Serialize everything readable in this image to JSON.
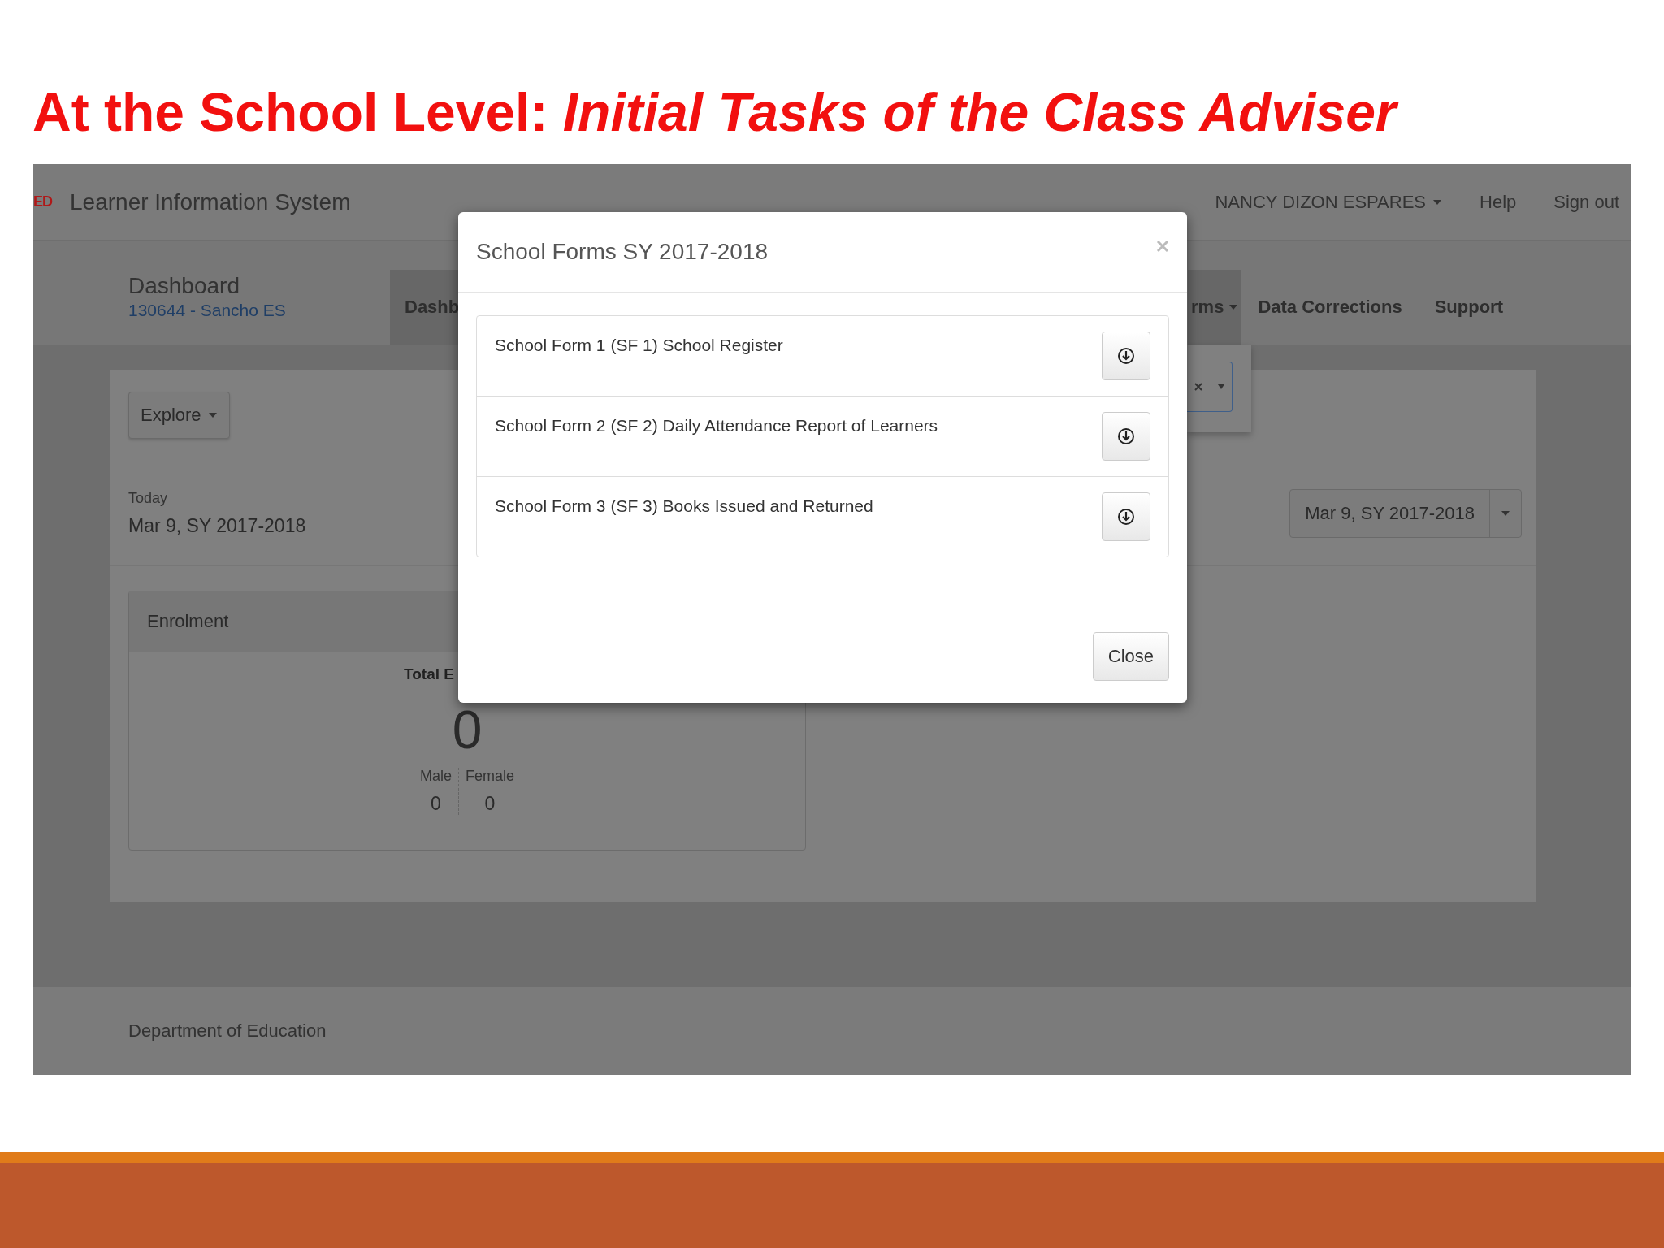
{
  "slide": {
    "title": "At the School Level: *Initial Tasks of the Class Adviser*"
  },
  "app": {
    "logo": "ED",
    "name": "Learner Information System",
    "user_menu": "NANCY DIZON ESPARES",
    "top_links": [
      "Help",
      "Sign out"
    ],
    "header": {
      "title": "Dashboard",
      "subtitle": "130644 - Sancho ES"
    },
    "nav_left": [
      {
        "label": "Dashb",
        "selected": true
      }
    ],
    "nav_right": [
      {
        "label": "rms",
        "selected": true,
        "dropdown": true
      },
      {
        "label": "Data Corrections",
        "selected": false,
        "dropdown": false
      },
      {
        "label": "Support",
        "selected": false,
        "dropdown": false
      }
    ],
    "explore_button": "Explore",
    "today": {
      "label": "Today",
      "value": "Mar 9, SY 2017-2018"
    },
    "date_picker": "Mar 9, SY 2017-2018",
    "enrolment": {
      "title": "Enrolment",
      "total_label": "Total E",
      "total": "0",
      "male_label": "Male",
      "male": "0",
      "female_label": "Female",
      "female": "0"
    },
    "footer": "Department of Education"
  },
  "modal": {
    "title": "School Forms SY 2017-2018",
    "forms": [
      "School Form 1 (SF 1) School Register",
      "School Form 2 (SF 2) Daily Attendance Report of Learners",
      "School Form 3 (SF 3) Books Issued and Returned"
    ],
    "close_button": "Close"
  }
}
